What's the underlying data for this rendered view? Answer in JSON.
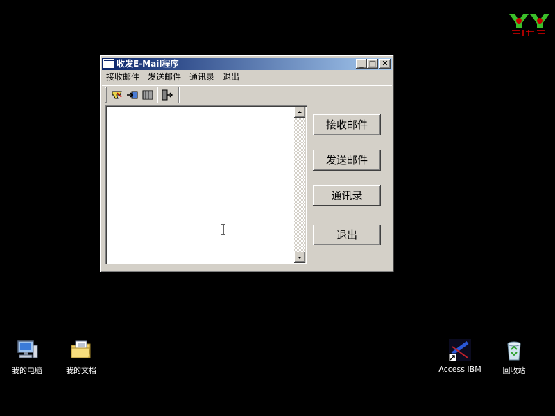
{
  "desktop": {
    "icons": [
      {
        "label": "我的电脑",
        "icon": "my-computer-icon"
      },
      {
        "label": "我的文档",
        "icon": "my-documents-icon"
      },
      {
        "label": "Access IBM",
        "icon": "access-ibm-icon"
      },
      {
        "label": "回收站",
        "icon": "recycle-bin-icon"
      }
    ]
  },
  "window": {
    "title": "收发E-Mail程序",
    "menu": [
      "接收邮件",
      "发送邮件",
      "通讯录",
      "退出"
    ],
    "toolbar": [
      "receive-mail-icon",
      "send-mail-icon",
      "address-book-icon",
      "exit-icon"
    ],
    "buttons": [
      "接收邮件",
      "发送邮件",
      "通讯录",
      "退出"
    ],
    "caption_buttons": {
      "minimize": "_",
      "maximize": "□",
      "close": "✕"
    }
  },
  "colors": {
    "desktop_bg": "#000000",
    "titlebar_start": "#0a246a",
    "titlebar_end": "#a6caf0",
    "face": "#d4d0c8"
  }
}
